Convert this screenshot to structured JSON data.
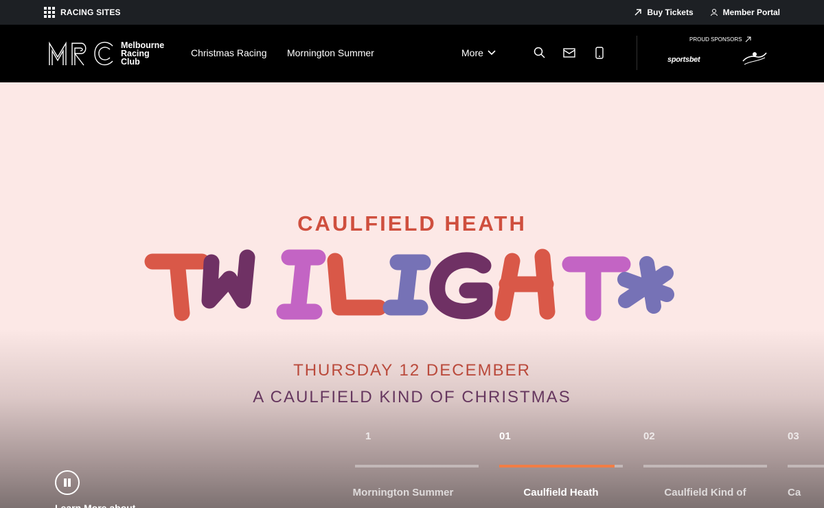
{
  "topbar": {
    "racing_sites": "RACING SITES",
    "buy_tickets": "Buy Tickets",
    "member_portal": "Member Portal"
  },
  "nav": {
    "logo_line1": "Melbourne",
    "logo_line2": "Racing",
    "logo_line3": "Club",
    "links": [
      "Christmas Racing",
      "Mornington Summer"
    ],
    "more": "More",
    "proud_sponsors": "PROUD SPONSORS",
    "sportsbet": "sportsbet"
  },
  "hero": {
    "kicker": "CAULFIELD HEATH",
    "title": "TWILIGHT",
    "date": "THURSDAY 12 DECEMBER",
    "tagline": "A CAULFIELD KIND OF CHRISTMAS",
    "clipped_label": "Learn More about",
    "slides": [
      {
        "number": "1",
        "title": "Mornington Summer"
      },
      {
        "number": "01",
        "title": "Caulfield Heath"
      },
      {
        "number": "02",
        "title": "Caulfield Kind of"
      },
      {
        "number": "03",
        "title": "Ca"
      }
    ]
  },
  "icons": {
    "grid": "grid-icon",
    "arrow": "arrow-up-right-icon",
    "user": "user-icon",
    "search": "search-icon",
    "mail": "mail-icon",
    "phone": "phone-icon",
    "chevron": "chevron-down-icon",
    "pause": "pause-icon"
  },
  "colors": {
    "accent": "#f27d45",
    "hero_background": "#fce8e6",
    "kicker": "#cf4f3e",
    "tagline": "#66375f"
  }
}
